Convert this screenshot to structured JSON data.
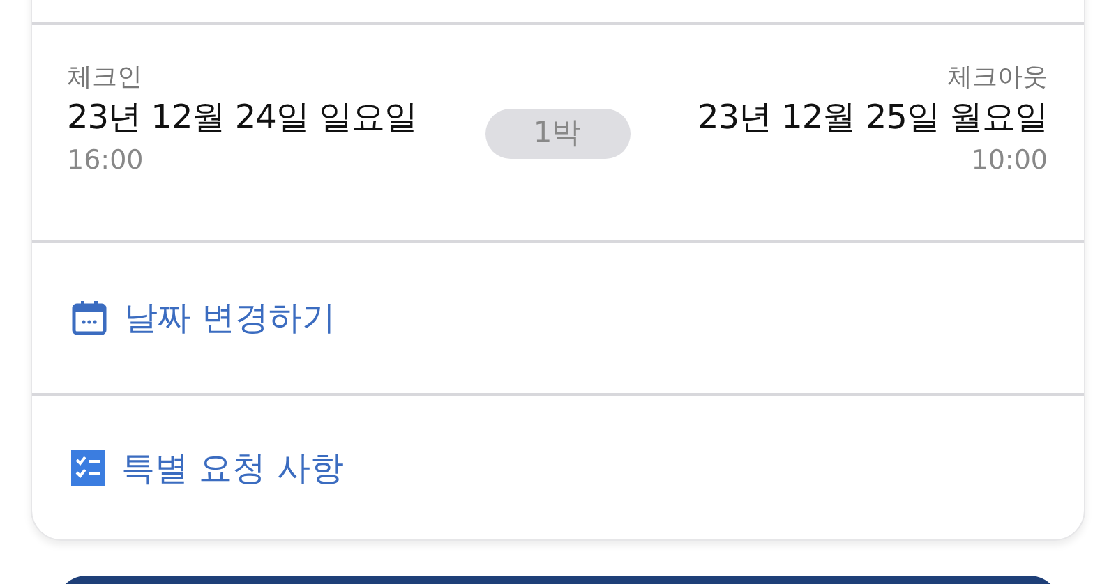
{
  "checkin": {
    "label": "체크인",
    "date": "23년 12월 24일 일요일",
    "time": "16:00"
  },
  "nights": "1박",
  "checkout": {
    "label": "체크아웃",
    "date": "23년 12월 25일 월요일",
    "time": "10:00"
  },
  "actions": [
    {
      "kind": "calendar",
      "label": "날짜 변경하기"
    },
    {
      "kind": "checklist",
      "label": "특별 요청 사항"
    }
  ]
}
